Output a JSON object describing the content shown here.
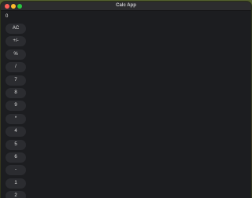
{
  "window": {
    "title": "Calc App"
  },
  "display": {
    "value": "0"
  },
  "keys": [
    "AC",
    "+/-",
    "%",
    "/",
    "7",
    "8",
    "9",
    "*",
    "4",
    "5",
    "6",
    "-",
    "1",
    "2"
  ],
  "colors": {
    "window_bg": "#1c1d20",
    "titlebar_bg": "#2c2c2e",
    "key_bg": "#2b2c30",
    "text": "#e2e2e2",
    "close": "#ff5f57",
    "minimize": "#febc2e",
    "maximize": "#28c840"
  }
}
